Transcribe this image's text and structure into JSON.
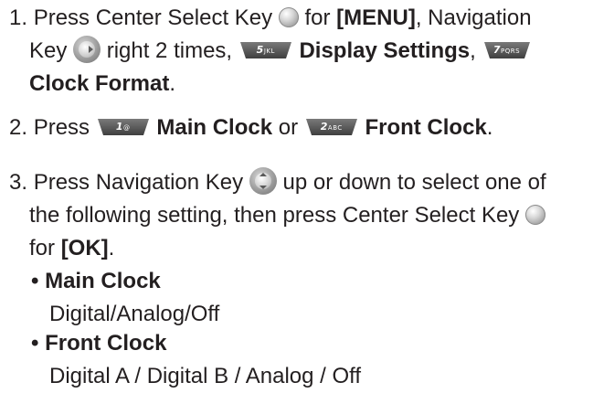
{
  "step1": {
    "num": "1.",
    "press": "Press Center Select Key",
    "for": "for",
    "menu": "[MENU]",
    "nav_sep": ", Navigation",
    "key_word": "Key",
    "right_times": "right 2 times,",
    "key5_label": "5",
    "key5_sub": "JKL",
    "display_settings": "Display Settings",
    "comma": ",",
    "key7_label": "7",
    "key7_sub": "PQRS",
    "clock_format": "Clock Format",
    "period": "."
  },
  "step2": {
    "num": "2.",
    "press": "Press",
    "key1_label": "1",
    "key1_sub": "@",
    "main_clock": "Main Clock",
    "or": "or",
    "key2_label": "2",
    "key2_sub": "ABC",
    "front_clock": "Front Clock",
    "period": "."
  },
  "step3": {
    "num": "3.",
    "press": "Press Navigation Key",
    "line1_rest": "up or down to select one of",
    "line2": "the following setting, then press Center Select Key",
    "for": "for",
    "ok": "[OK]",
    "period": "."
  },
  "options": [
    {
      "bullet": "•",
      "title": "Main Clock",
      "values": "Digital/Analog/Off"
    },
    {
      "bullet": "•",
      "title": "Front Clock",
      "values": "Digital A / Digital B / Analog / Off"
    }
  ],
  "colors": {
    "text": "#231f20",
    "key_dark": "#5a5a5a",
    "key_gray": "#9a9a9a"
  },
  "icons": {
    "center_select_key": "center-select-key-icon",
    "navigation_key_right": "navigation-key-right-icon",
    "navigation_key_updown": "navigation-key-updown-icon",
    "keypad_key": "keypad-key-icon"
  }
}
